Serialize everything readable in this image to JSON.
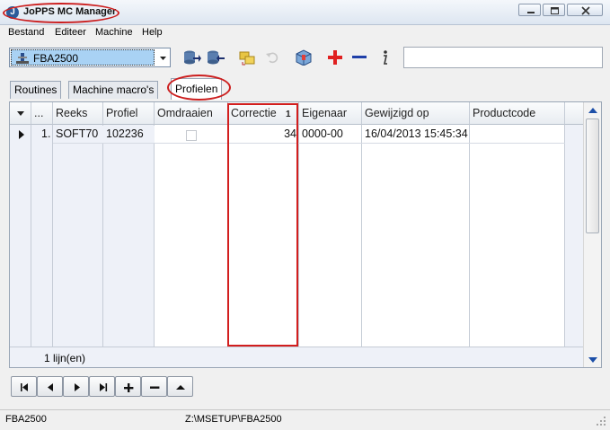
{
  "window": {
    "title": "JoPPS MC Manager",
    "app_icon": "J"
  },
  "menu": [
    "Bestand",
    "Editeer",
    "Machine",
    "Help"
  ],
  "toolbar": {
    "machine_select_value": "FBA2500",
    "search_value": "",
    "icons": [
      "database-arrow-right-icon",
      "database-arrow-left-icon",
      "folder-copy-icon",
      "undo-icon",
      "package-icon",
      "add-icon",
      "remove-icon",
      "info-icon"
    ]
  },
  "tabs": [
    {
      "label": "Routines"
    },
    {
      "label": "Machine macro's"
    },
    {
      "label": "Profielen",
      "active": true
    }
  ],
  "grid": {
    "columns": [
      {
        "label": ""
      },
      {
        "label": "..."
      },
      {
        "label": "Reeks"
      },
      {
        "label": "Profiel"
      },
      {
        "label": "Omdraaien"
      },
      {
        "label": "Correctie",
        "sort_indicator": "1"
      },
      {
        "label": "Eigenaar"
      },
      {
        "label": "Gewijzigd op"
      },
      {
        "label": "Productcode"
      }
    ],
    "rows": [
      {
        "index": "1.",
        "reeks": "SOFT70",
        "profiel": "102236",
        "omdraaien": false,
        "correctie": "34",
        "eigenaar": "0000-00",
        "gewijzigd_op": "16/04/2013 15:45:34",
        "productcode": ""
      }
    ],
    "footer": "1 lijn(en)"
  },
  "status": {
    "left": "FBA2500",
    "path": "Z:\\MSETUP\\FBA2500"
  },
  "colors": {
    "highlight": "#d21e1e",
    "selected_combo": "#a9d2f4",
    "add": "#e02020",
    "remove": "#1f3fa8"
  }
}
